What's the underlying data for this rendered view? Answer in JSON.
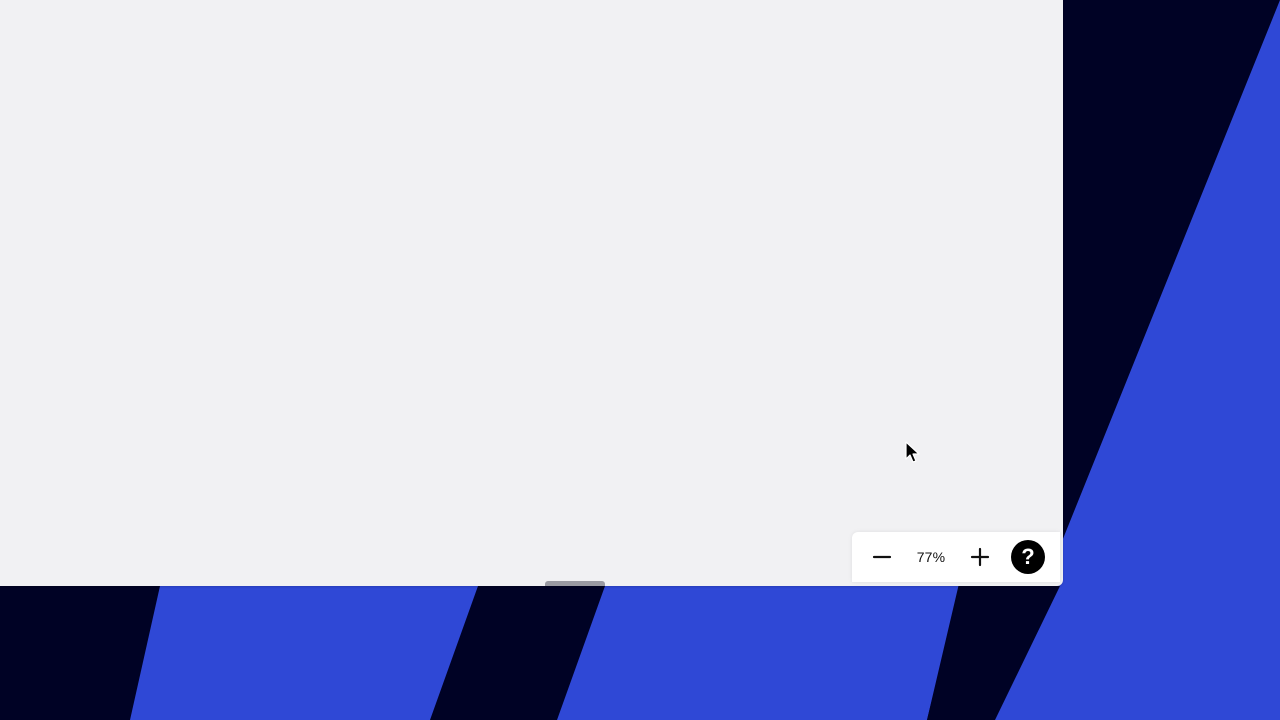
{
  "colors": {
    "wallpaper_blue": "#2f48d6",
    "wallpaper_navy": "#000225",
    "canvas_bg": "#f1f1f3",
    "toolbar_bg": "#ffffff",
    "help_bg": "#000000"
  },
  "zoom_controls": {
    "zoom_out_icon": "minus-icon",
    "zoom_level": "77%",
    "zoom_in_icon": "plus-icon",
    "help_icon": "question-mark-icon",
    "help_glyph": "?"
  },
  "cursor": {
    "icon": "arrow-pointer-icon"
  }
}
